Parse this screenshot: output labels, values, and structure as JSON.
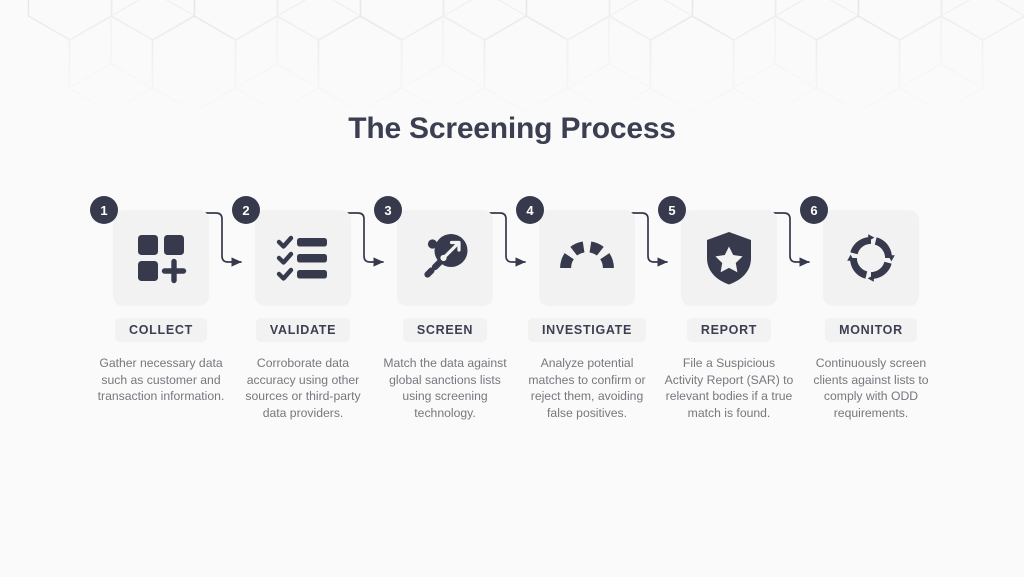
{
  "page": {
    "title": "The Screening Process",
    "background_color": "#fafafa",
    "accent_dark": "#363a4c",
    "card_gray": "#f2f2f3",
    "text_gray": "#77777e",
    "title_color": "#3b3f51"
  },
  "background_pattern": {
    "name": "hexagon-cube-outline-pattern",
    "stroke_color": "#eeeeef"
  },
  "steps": [
    {
      "number": "1",
      "label": "COLLECT",
      "icon": "grid-plus-icon",
      "description": "Gather necessary data such as customer and transaction information."
    },
    {
      "number": "2",
      "label": "VALIDATE",
      "icon": "checklist-icon",
      "description": "Corroborate data accuracy using other sources or third-party data providers."
    },
    {
      "number": "3",
      "label": "SCREEN",
      "icon": "target-search-icon",
      "description": "Match the data against global sanctions lists using screening technology."
    },
    {
      "number": "4",
      "label": "INVESTIGATE",
      "icon": "gauge-icon",
      "description": "Analyze potential matches to confirm or reject them, avoiding false positives."
    },
    {
      "number": "5",
      "label": "REPORT",
      "icon": "shield-star-icon",
      "description": "File a Suspicious Activity Report (SAR) to relevant bodies if a true match is found."
    },
    {
      "number": "6",
      "label": "MONITOR",
      "icon": "refresh-cycle-icon",
      "description": "Continuously screen clients against lists to comply with ODD requirements."
    }
  ],
  "connectors": [
    {
      "name": "connector-1-to-2"
    },
    {
      "name": "connector-2-to-3"
    },
    {
      "name": "connector-3-to-4"
    },
    {
      "name": "connector-4-to-5"
    },
    {
      "name": "connector-5-to-6"
    }
  ]
}
